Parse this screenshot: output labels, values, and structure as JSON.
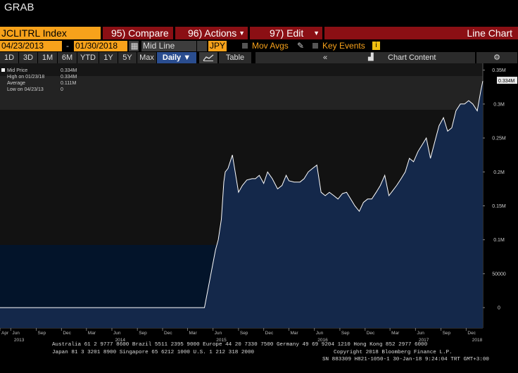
{
  "window": {
    "title": "GRAB"
  },
  "toolbar": {
    "ticker": "JCLITRL Index",
    "compare": "95) Compare",
    "actions": "96) Actions",
    "edit": "97) Edit",
    "chart_type": "Line Chart"
  },
  "controls": {
    "start_date": "04/23/2013",
    "date_sep": "-",
    "end_date": "01/30/2018",
    "field": "Mid Line",
    "currency": "JPY",
    "mov_avgs": "Mov Avgs",
    "key_events": "Key Events",
    "key_events_badge": "i"
  },
  "periods": {
    "items": [
      "1D",
      "3D",
      "1M",
      "6M",
      "YTD",
      "1Y",
      "5Y",
      "Max"
    ],
    "frequency": "Daily",
    "table": "Table",
    "nav": "«",
    "chart_content": "Chart Content",
    "settings": "⚙"
  },
  "legend": {
    "series": "Mid Price",
    "series_value": "0.334M",
    "high_label": "High on 01/23/18",
    "high_value": "0.334M",
    "avg_label": "Average",
    "avg_value": "0.111M",
    "low_label": "Low on 04/23/13",
    "low_value": "0"
  },
  "footer": {
    "line1": "Australia 61 2 9777 8600 Brazil 5511 2395 9000 Europe 44 20 7330 7500 Germany 49 69 9204 1210 Hong Kong 852 2977 6000",
    "line2": "Japan 81 3 3201 8900        Singapore 65 6212 1000        U.S. 1 212 318 2000",
    "copyright": "Copyright 2018 Bloomberg Finance L.P.",
    "line3": "SN 883309 H821-1050-1 30-Jan-18  9:24:04 TRT  GMT+3:00"
  },
  "colors": {
    "accent_orange": "#f7a21b",
    "menu_red": "#8b0f14",
    "fill_blue": "#14284a",
    "line": "#ffffff"
  },
  "chart_data": {
    "type": "area",
    "series": [
      {
        "name": "Mid Price",
        "x": [
          "2013-04-23",
          "2014-01-15",
          "2014-06-01",
          "2015-01-01",
          "2015-03-20",
          "2015-04-10",
          "2015-05-01",
          "2015-05-20",
          "2015-06-10",
          "2015-06-20",
          "2015-07-01",
          "2015-07-10",
          "2015-07-15",
          "2015-07-25",
          "2015-08-10",
          "2015-09-01",
          "2015-09-15",
          "2015-10-01",
          "2015-10-20",
          "2015-11-01",
          "2015-11-15",
          "2015-12-01",
          "2015-12-15",
          "2016-01-01",
          "2016-01-20",
          "2016-02-05",
          "2016-02-20",
          "2016-03-01",
          "2016-03-20",
          "2016-04-10",
          "2016-04-25",
          "2016-05-10",
          "2016-05-25",
          "2016-06-10",
          "2016-06-25",
          "2016-07-10",
          "2016-07-25",
          "2016-08-10",
          "2016-08-25",
          "2016-09-10",
          "2016-09-25",
          "2016-10-10",
          "2016-10-25",
          "2016-11-10",
          "2016-11-25",
          "2016-12-10",
          "2016-12-25",
          "2017-01-10",
          "2017-01-25",
          "2017-02-10",
          "2017-02-25",
          "2017-03-10",
          "2017-03-25",
          "2017-04-10",
          "2017-04-25",
          "2017-05-10",
          "2017-05-25",
          "2017-06-10",
          "2017-06-25",
          "2017-07-10",
          "2017-07-25",
          "2017-08-10",
          "2017-08-25",
          "2017-09-10",
          "2017-09-25",
          "2017-10-10",
          "2017-10-25",
          "2017-11-10",
          "2017-11-25",
          "2017-12-10",
          "2017-12-25",
          "2018-01-10",
          "2018-01-23",
          "2018-01-30"
        ],
        "y": [
          0,
          0,
          0,
          0,
          0,
          0,
          0,
          0.04,
          0.085,
          0.1,
          0.13,
          0.185,
          0.2,
          0.205,
          0.225,
          0.17,
          0.18,
          0.188,
          0.19,
          0.19,
          0.195,
          0.183,
          0.2,
          0.19,
          0.175,
          0.18,
          0.195,
          0.187,
          0.185,
          0.185,
          0.19,
          0.2,
          0.205,
          0.21,
          0.17,
          0.165,
          0.17,
          0.165,
          0.16,
          0.168,
          0.17,
          0.16,
          0.15,
          0.142,
          0.155,
          0.16,
          0.16,
          0.17,
          0.18,
          0.195,
          0.165,
          0.172,
          0.18,
          0.19,
          0.2,
          0.22,
          0.215,
          0.23,
          0.24,
          0.25,
          0.22,
          0.245,
          0.268,
          0.28,
          0.26,
          0.265,
          0.29,
          0.3,
          0.3,
          0.305,
          0.3,
          0.29,
          0.32,
          0.334
        ]
      }
    ],
    "ylim": [
      -0.03,
      0.36
    ],
    "y_ticks": [
      0,
      0.05,
      0.1,
      0.15,
      0.2,
      0.25,
      0.3,
      0.35
    ],
    "y_tick_labels": [
      "0",
      "50000",
      "0.1M",
      "0.15M",
      "0.2M",
      "0.25M",
      "0.3M",
      "0.35M"
    ],
    "last_value_label": "0.334M",
    "x_ticks": [
      {
        "date": "2013-04-23",
        "label": "Apr"
      },
      {
        "date": "2013-06-01",
        "label": "Jun"
      },
      {
        "date": "2013-09-01",
        "label": "Sep"
      },
      {
        "date": "2013-12-01",
        "label": "Dec"
      },
      {
        "date": "2014-03-01",
        "label": "Mar"
      },
      {
        "date": "2014-06-01",
        "label": "Jun"
      },
      {
        "date": "2014-09-01",
        "label": "Sep"
      },
      {
        "date": "2014-12-01",
        "label": "Dec"
      },
      {
        "date": "2015-03-01",
        "label": "Mar"
      },
      {
        "date": "2015-06-01",
        "label": "Jun"
      },
      {
        "date": "2015-09-01",
        "label": "Sep"
      },
      {
        "date": "2015-12-01",
        "label": "Dec"
      },
      {
        "date": "2016-03-01",
        "label": "Mar"
      },
      {
        "date": "2016-06-01",
        "label": "Jun"
      },
      {
        "date": "2016-09-01",
        "label": "Sep"
      },
      {
        "date": "2016-12-01",
        "label": "Dec"
      },
      {
        "date": "2017-03-01",
        "label": "Mar"
      },
      {
        "date": "2017-06-01",
        "label": "Jun"
      },
      {
        "date": "2017-09-01",
        "label": "Sep"
      },
      {
        "date": "2017-12-01",
        "label": "Dec"
      }
    ],
    "x_year_labels": [
      {
        "date": "2013-07-01",
        "label": "2013"
      },
      {
        "date": "2014-07-01",
        "label": "2014"
      },
      {
        "date": "2015-07-01",
        "label": "2015"
      },
      {
        "date": "2016-07-01",
        "label": "2016"
      },
      {
        "date": "2017-07-01",
        "label": "2017"
      },
      {
        "date": "2018-01-15",
        "label": "2018"
      }
    ],
    "x_range": [
      "2013-04-23",
      "2018-01-30"
    ],
    "grid": false,
    "legend_position": "top-left"
  }
}
